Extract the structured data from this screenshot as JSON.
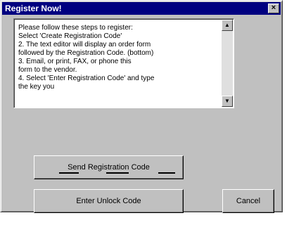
{
  "window": {
    "title": "Register Now!",
    "close_symbol": "×"
  },
  "instructions": {
    "text": "Please follow these steps to register:\n  Select 'Create Registration Code'\n2. The text editor will display an order form\n  followed by the Registration Code. (bottom)\n3. Email, or print, FAX, or phone this\n  form to the vendor.\n4. Select 'Enter Registration Code' and type\n  the key you"
  },
  "scrollbar": {
    "up_arrow": "▲",
    "down_arrow": "▼"
  },
  "buttons": {
    "send_label": "Send Registration Code",
    "enter_label": "Enter Unlock Code",
    "cancel_label": "Cancel"
  },
  "colors": {
    "face": "#c0c0c0",
    "titlebar": "#000080",
    "text": "#000000",
    "white": "#ffffff"
  }
}
